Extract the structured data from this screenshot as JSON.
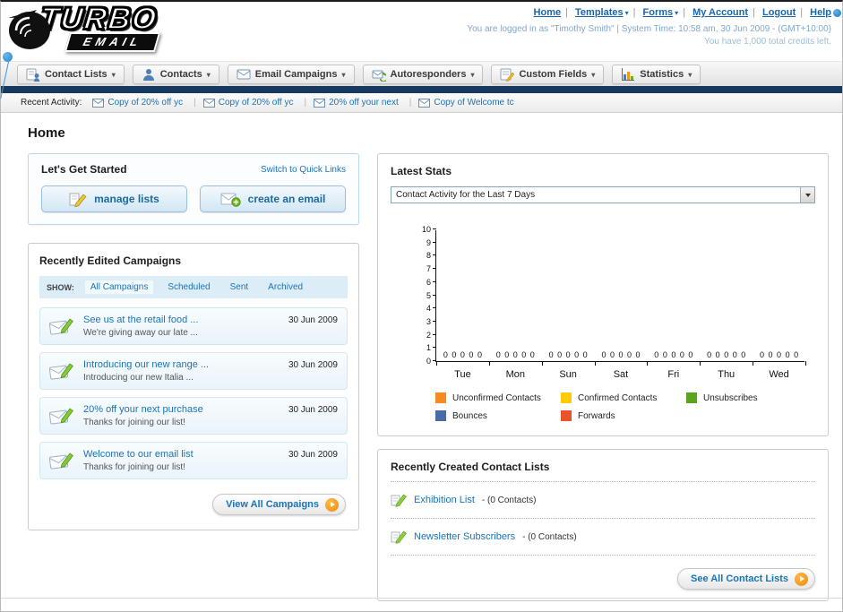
{
  "header": {
    "logo_line1": "TURBO",
    "logo_line2": "EMAIL",
    "nav_links": [
      {
        "label": "Home",
        "caret": false
      },
      {
        "label": "Templates",
        "caret": true
      },
      {
        "label": "Forms",
        "caret": true
      },
      {
        "label": "My Account",
        "caret": false
      },
      {
        "label": "Logout",
        "caret": false
      },
      {
        "label": "Help",
        "caret": false
      }
    ],
    "login_info": "You are logged in as \"Timothy Smith\" | System Time: 10:58 am, 30 Jun 2009 - (GMT+10:00)",
    "credits_info": "You have 1,000 total credits left."
  },
  "nav_tabs": [
    {
      "label": "Contact Lists"
    },
    {
      "label": "Contacts"
    },
    {
      "label": "Email Campaigns"
    },
    {
      "label": "Autoresponders"
    },
    {
      "label": "Custom Fields"
    },
    {
      "label": "Statistics"
    }
  ],
  "recent_activity": {
    "label": "Recent Activity:",
    "items": [
      {
        "label": "Copy of 20% off yc"
      },
      {
        "label": "Copy of 20% off yc"
      },
      {
        "label": "20% off your next"
      },
      {
        "label": "Copy of Welcome tc"
      }
    ]
  },
  "page_title": "Home",
  "get_started": {
    "title": "Let's Get Started",
    "switch_link": "Switch to Quick Links",
    "manage_lists_label": "manage lists",
    "create_email_label": "create an email"
  },
  "campaigns": {
    "title": "Recently Edited Campaigns",
    "show_label": "SHOW:",
    "filters": [
      {
        "label": "All Campaigns",
        "selected": true
      },
      {
        "label": "Scheduled",
        "selected": false
      },
      {
        "label": "Sent",
        "selected": false
      },
      {
        "label": "Archived",
        "selected": false
      }
    ],
    "items": [
      {
        "title": "See us at the retail food ...",
        "subtitle": "We're giving away our late ...",
        "date": "30 Jun 2009"
      },
      {
        "title": "Introducing our new range ...",
        "subtitle": "Introducing our new Italia ...",
        "date": "30 Jun 2009"
      },
      {
        "title": "20% off your next purchase",
        "subtitle": "Thanks for joining our list!",
        "date": "30 Jun 2009"
      },
      {
        "title": "Welcome to our email list",
        "subtitle": "Thanks for joining our list!",
        "date": "30 Jun 2009"
      }
    ],
    "view_all_label": "View All Campaigns"
  },
  "stats": {
    "title": "Latest Stats",
    "dropdown_value": "Contact Activity for the Last 7 Days",
    "chart_data": {
      "type": "bar",
      "title": "Contact Activity for the Last 7 Days",
      "categories": [
        "Tue",
        "Mon",
        "Sun",
        "Sat",
        "Fri",
        "Thu",
        "Wed"
      ],
      "series": [
        {
          "name": "Unconfirmed Contacts",
          "color": "#f6891f",
          "values": [
            0,
            0,
            0,
            0,
            0,
            0,
            0
          ]
        },
        {
          "name": "Confirmed Contacts",
          "color": "#ffcb05",
          "values": [
            0,
            0,
            0,
            0,
            0,
            0,
            0
          ]
        },
        {
          "name": "Unsubscribes",
          "color": "#5ba41e",
          "values": [
            0,
            0,
            0,
            0,
            0,
            0,
            0
          ]
        },
        {
          "name": "Bounces",
          "color": "#4a69a9",
          "values": [
            0,
            0,
            0,
            0,
            0,
            0,
            0
          ]
        },
        {
          "name": "Forwards",
          "color": "#e8542c",
          "values": [
            0,
            0,
            0,
            0,
            0,
            0,
            0
          ]
        }
      ],
      "ylim": [
        0,
        10
      ],
      "yticks": [
        0,
        1,
        2,
        3,
        4,
        5,
        6,
        7,
        8,
        9,
        10
      ],
      "grid": false,
      "legend_position": "bottom"
    }
  },
  "contact_lists": {
    "title": "Recently Created Contact Lists",
    "items": [
      {
        "name": "Exhibition List",
        "detail": "- (0 Contacts)"
      },
      {
        "name": "Newsletter Subscribers",
        "detail": "- (0 Contacts)"
      }
    ],
    "see_all_label": "See All Contact Lists"
  }
}
